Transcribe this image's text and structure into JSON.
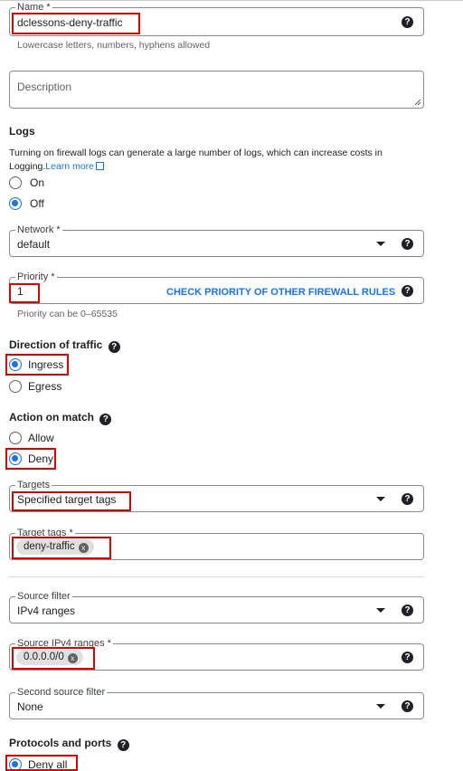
{
  "name_field": {
    "label": "Name *",
    "value": "dclessons-deny-traffic",
    "hint": "Lowercase letters, numbers, hyphens allowed"
  },
  "description_field": {
    "placeholder": "Description"
  },
  "logs": {
    "title": "Logs",
    "text": "Turning on firewall logs can generate a large number of logs, which can increase costs in Logging.",
    "learn_more": "Learn more",
    "options": [
      "On",
      "Off"
    ],
    "selected": "Off"
  },
  "network_field": {
    "label": "Network *",
    "value": "default"
  },
  "priority_field": {
    "label": "Priority *",
    "value": "1",
    "link": "CHECK PRIORITY OF OTHER FIREWALL RULES",
    "hint": "Priority can be 0–65535"
  },
  "direction": {
    "title": "Direction of traffic",
    "options": [
      "Ingress",
      "Egress"
    ],
    "selected": "Ingress"
  },
  "action": {
    "title": "Action on match",
    "options": [
      "Allow",
      "Deny"
    ],
    "selected": "Deny"
  },
  "targets_field": {
    "label": "Targets",
    "value": "Specified target tags"
  },
  "target_tags_field": {
    "label": "Target tags *",
    "chip": "deny-traffic"
  },
  "source_filter_field": {
    "label": "Source filter",
    "value": "IPv4 ranges"
  },
  "source_ranges_field": {
    "label": "Source IPv4 ranges *",
    "chip": "0.0.0.0/0"
  },
  "second_source_field": {
    "label": "Second source filter",
    "value": "None"
  },
  "protocols": {
    "title": "Protocols and ports",
    "options": [
      "Deny all"
    ],
    "selected": "Deny all"
  },
  "icons": {
    "help": "?",
    "chip_remove": "x"
  },
  "highlight_color": "#d50000",
  "accent_color": "#1a73e8"
}
